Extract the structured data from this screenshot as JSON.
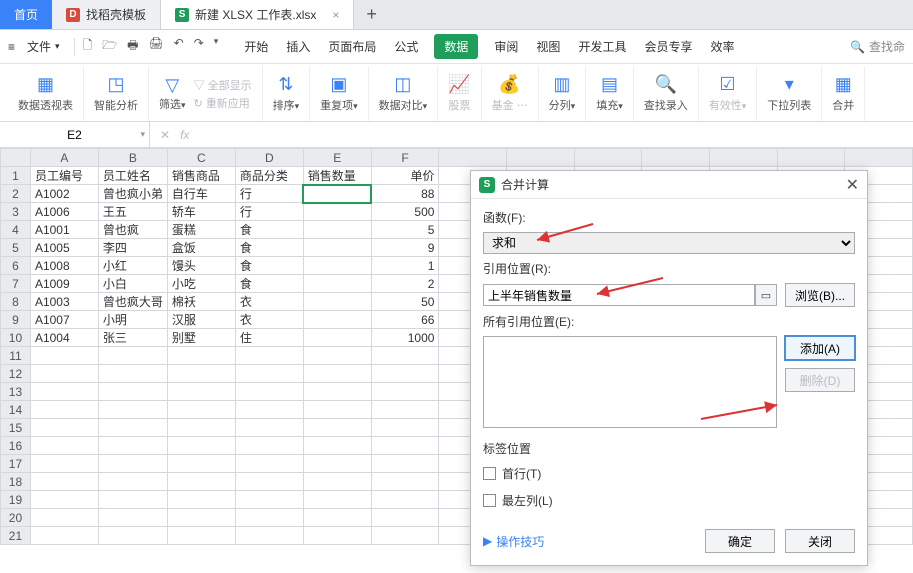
{
  "tabs": {
    "home": "首页",
    "t1": {
      "icon": "D",
      "label": "找稻壳模板"
    },
    "t2": {
      "icon": "S",
      "label": "新建 XLSX 工作表.xlsx"
    },
    "close": "×",
    "plus": "+"
  },
  "menubar": {
    "menu_icon": "≡",
    "file": "文件",
    "caret": "▾",
    "qat": [
      "🗋",
      "🗁",
      "🖶",
      "🖨",
      "↶",
      "↷"
    ],
    "items": [
      "开始",
      "插入",
      "页面布局",
      "公式",
      "数据",
      "审阅",
      "视图",
      "开发工具",
      "会员专享",
      "效率"
    ],
    "active_index": 4,
    "search_icon": "🔍",
    "search": "查找命"
  },
  "ribbon": {
    "g0": {
      "label": "数据透视表"
    },
    "g1": {
      "label": "智能分析"
    },
    "g2": {
      "label": "筛选",
      "caret": "▾",
      "s1": "全部显示",
      "s2": "重新应用"
    },
    "g3": {
      "label": "排序",
      "caret": "▾"
    },
    "g4": {
      "label": "重复项",
      "caret": "▾"
    },
    "g5": {
      "label": "数据对比",
      "caret": "▾"
    },
    "g6": {
      "label": "股票"
    },
    "g7": {
      "label": "基金"
    },
    "g8": {
      "label": "分列",
      "caret": "▾"
    },
    "g9": {
      "label": "填充",
      "caret": "▾"
    },
    "g10": {
      "label": "查找录入"
    },
    "g11": {
      "label": "有效性",
      "caret": "▾"
    },
    "g12": {
      "label": "下拉列表"
    },
    "g13": {
      "label": "合并"
    }
  },
  "namebox": {
    "value": "E2",
    "fx": "fx"
  },
  "columns": [
    "A",
    "B",
    "C",
    "D",
    "E",
    "F",
    "",
    "",
    "",
    "",
    "",
    "",
    ""
  ],
  "headers": [
    "员工编号",
    "员工姓名",
    "销售商品",
    "商品分类",
    "销售数量",
    "单价"
  ],
  "rows": [
    {
      "n": 1,
      "a": "员工编号",
      "b": "员工姓名",
      "c": "销售商品",
      "d": "商品分类",
      "e": "销售数量",
      "f": "单价"
    },
    {
      "n": 2,
      "a": "A1002",
      "b": "曾也疯小弟",
      "c": "自行车",
      "d": "行",
      "e": "",
      "f": "88"
    },
    {
      "n": 3,
      "a": "A1006",
      "b": "王五",
      "c": "轿车",
      "d": "行",
      "e": "",
      "f": "500"
    },
    {
      "n": 4,
      "a": "A1001",
      "b": "曾也疯",
      "c": "蛋糕",
      "d": "食",
      "e": "",
      "f": "5"
    },
    {
      "n": 5,
      "a": "A1005",
      "b": "李四",
      "c": "盒饭",
      "d": "食",
      "e": "",
      "f": "9"
    },
    {
      "n": 6,
      "a": "A1008",
      "b": "小红",
      "c": "馒头",
      "d": "食",
      "e": "",
      "f": "1"
    },
    {
      "n": 7,
      "a": "A1009",
      "b": "小白",
      "c": "小吃",
      "d": "食",
      "e": "",
      "f": "2"
    },
    {
      "n": 8,
      "a": "A1003",
      "b": "曾也疯大哥",
      "c": "棉袄",
      "d": "衣",
      "e": "",
      "f": "50"
    },
    {
      "n": 9,
      "a": "A1007",
      "b": "小明",
      "c": "汉服",
      "d": "衣",
      "e": "",
      "f": "66"
    },
    {
      "n": 10,
      "a": "A1004",
      "b": "张三",
      "c": "别墅",
      "d": "住",
      "e": "",
      "f": "1000"
    }
  ],
  "empty_rows": [
    11,
    12,
    13,
    14,
    15,
    16,
    17,
    18,
    19,
    20,
    21
  ],
  "dialog": {
    "title": "合并计算",
    "func_label": "函数(F):",
    "func_value": "求和",
    "ref_label": "引用位置(R):",
    "ref_value": "上半年销售数量",
    "browse": "浏览(B)...",
    "all_label": "所有引用位置(E):",
    "add": "添加(A)",
    "delete": "删除(D)",
    "label_pos": "标签位置",
    "first_row": "首行(T)",
    "left_col": "最左列(L)",
    "tip": "操作技巧",
    "ok": "确定",
    "close": "关闭",
    "x": "✕"
  }
}
